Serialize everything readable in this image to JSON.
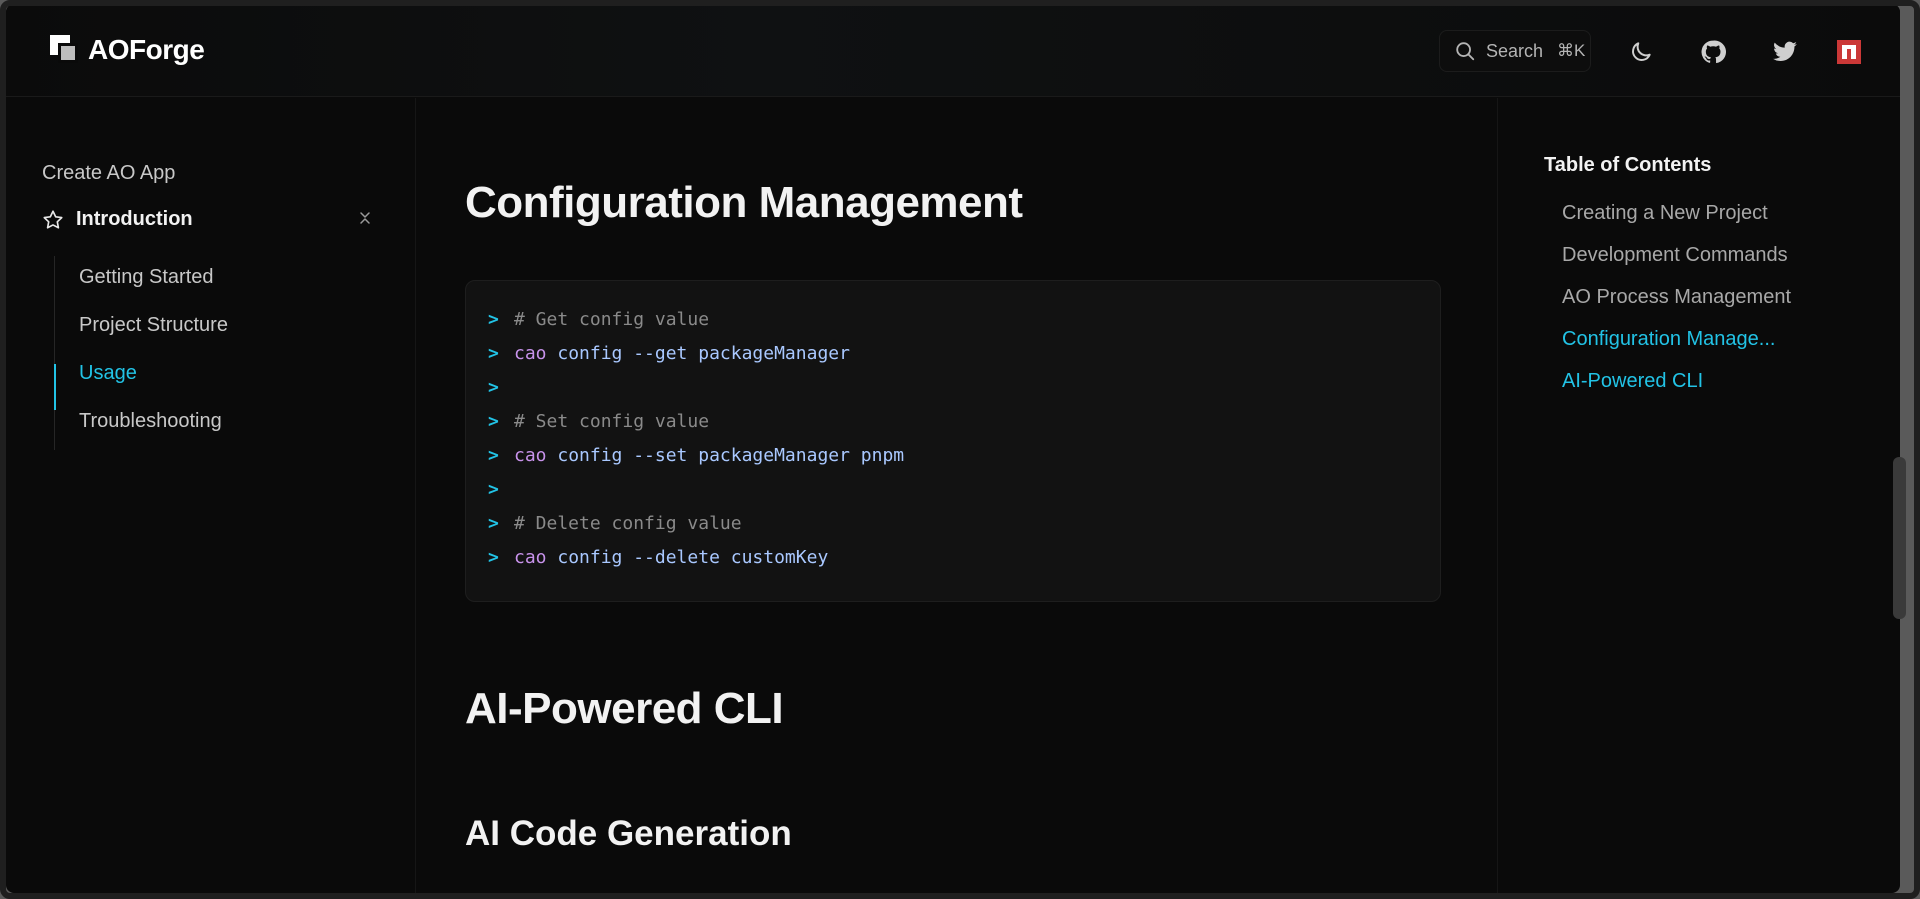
{
  "header": {
    "logo_text": "AOForge",
    "search_label": "Search",
    "search_shortcut": "⌘K",
    "icons": [
      "moon-icon",
      "github-icon",
      "twitter-icon",
      "npm-icon"
    ]
  },
  "sidebar": {
    "top_link": "Create AO App",
    "section_label": "Introduction",
    "items": [
      {
        "label": "Getting Started"
      },
      {
        "label": "Project Structure"
      },
      {
        "label": "Usage"
      },
      {
        "label": "Troubleshooting"
      }
    ],
    "active_item": "Usage"
  },
  "main": {
    "heading_config": "Configuration Management",
    "code_lines": [
      {
        "prompt": ">",
        "comment": "# Get config value"
      },
      {
        "prompt": ">",
        "cmd": "cao",
        "args": " config --get packageManager"
      },
      {
        "prompt": ">"
      },
      {
        "prompt": ">",
        "comment": "# Set config value"
      },
      {
        "prompt": ">",
        "cmd": "cao",
        "args": " config --set packageManager pnpm"
      },
      {
        "prompt": ">"
      },
      {
        "prompt": ">",
        "comment": "# Delete config value"
      },
      {
        "prompt": ">",
        "cmd": "cao",
        "args": " config --delete customKey"
      }
    ],
    "heading_ai": "AI-Powered CLI",
    "heading_gen": "AI Code Generation"
  },
  "toc": {
    "title": "Table of Contents",
    "items": [
      {
        "label": "Creating a New Project"
      },
      {
        "label": "Development Commands"
      },
      {
        "label": "AO Process Management"
      },
      {
        "label": "Configuration Manage..."
      },
      {
        "label": "AI-Powered CLI"
      }
    ]
  },
  "colors": {
    "accent": "#22c3e6",
    "background": "#0a0a0a",
    "keyword": "#c792ea",
    "argument": "#a9c8ff",
    "comment": "#8a8a8a"
  }
}
